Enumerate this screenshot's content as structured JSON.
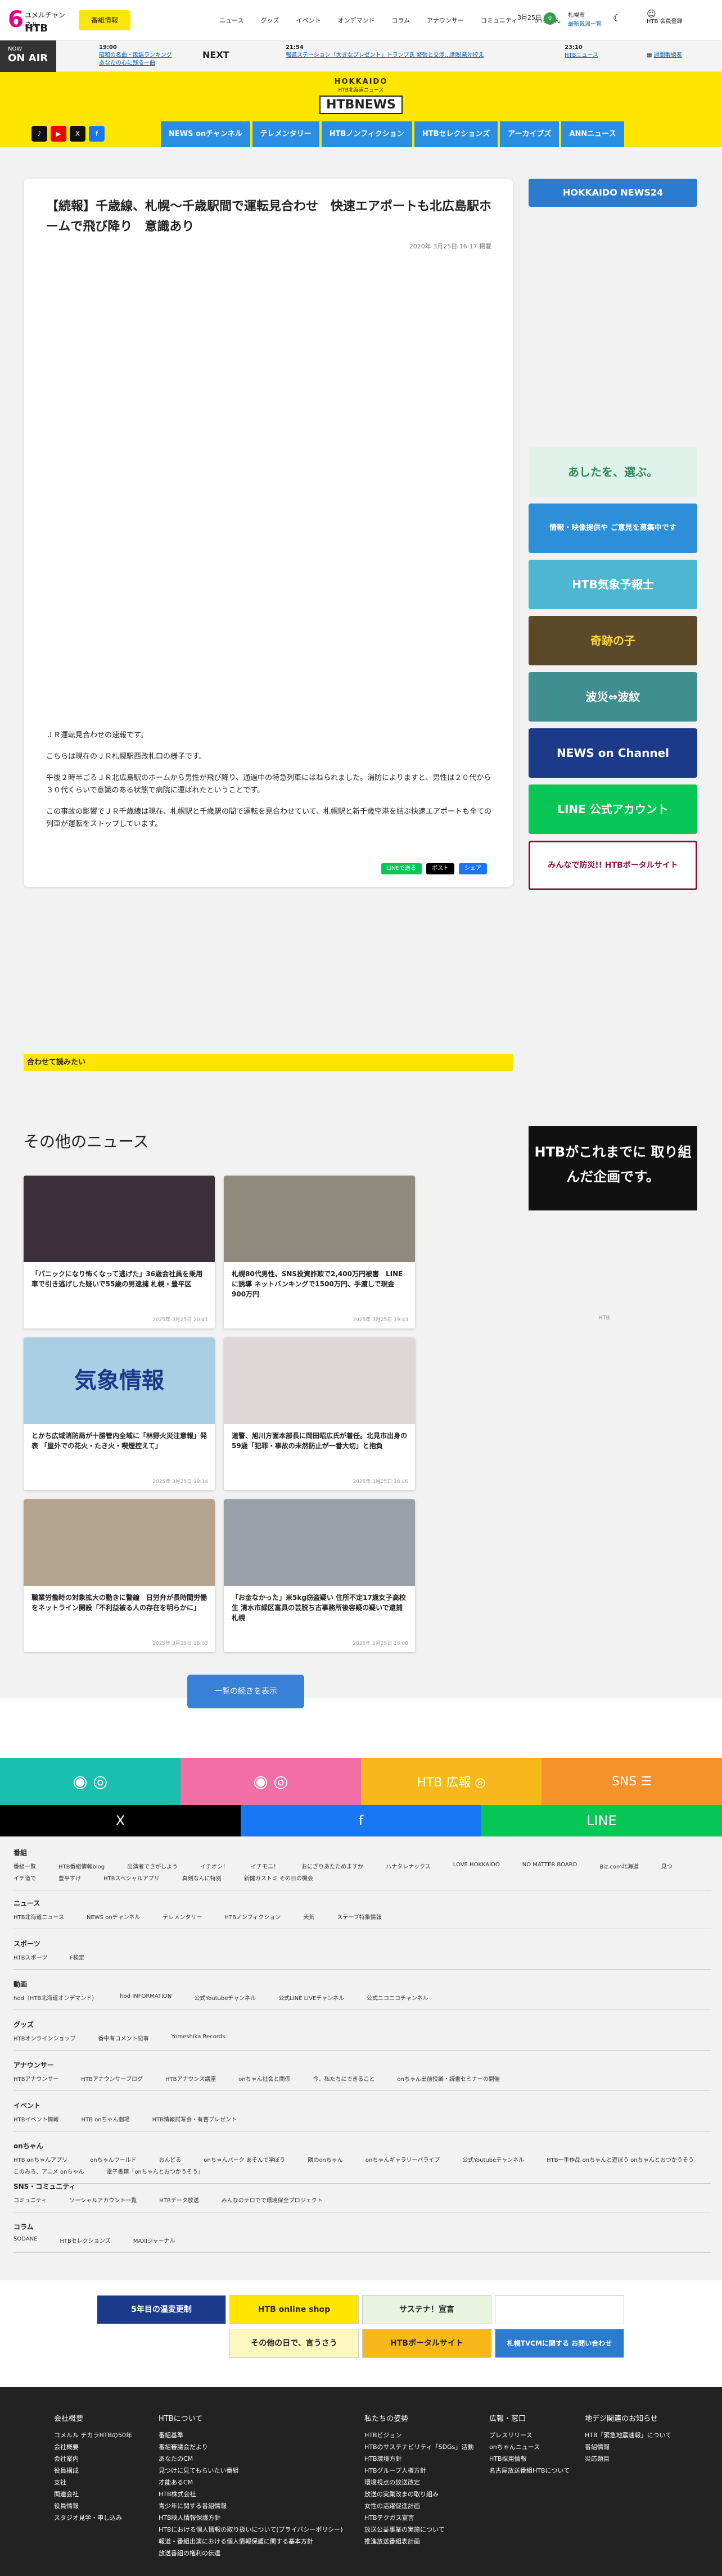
{
  "topbar": {
    "logo_kana": "ユメルチャンネル",
    "logo_six": "6",
    "logo_htb": "HTB",
    "yellow_button": "番組情報",
    "nav": [
      "ニュース",
      "グッズ",
      "イベント",
      "オンデマンド",
      "コラム",
      "アナウンサー",
      "コミュニティ",
      "onちゃん"
    ],
    "weather_date": "3月25日",
    "weather_badge": "0",
    "location_line1": "札幌市",
    "location_line2": "最新気温一覧",
    "account_line1": "HTB",
    "account_line2": "会員登録"
  },
  "onair": {
    "now_small": "NOW",
    "now_big": "ON AIR",
    "current_time": "19:00",
    "current_title": "昭和の名曲・歌謡ランキング",
    "current_sub": "あなたの心に残る一曲",
    "next_label": "NEXT",
    "next1_time": "21:54",
    "next1_title": "報道ステーション「大きなプレゼント」トランプ氏 緊張と交渉…関税発効控え",
    "next2_time": "23:10",
    "next2_title": "HTBニュース",
    "schedule": "週間番組表"
  },
  "header": {
    "hokkaido": "HOKKAIDO",
    "htb_news_sub": "HTB北海道ニュース",
    "logo": "HTBNEWS"
  },
  "social": [
    "♪",
    "▶",
    "X",
    "f"
  ],
  "menu": [
    "NEWS onチャンネル",
    "テレメンタリー",
    "HTBノンフィクション",
    "HTBセレクションズ",
    "アーカイブズ",
    "ANNニュース"
  ],
  "article": {
    "title": "【続報】千歳線、札幌～千歳駅間で運転見合わせ　快速エアポートも北広島駅ホームで飛び降り　意識あり",
    "date": "2020年 3月25日 16:17 掲載",
    "p1": "ＪＲ運転見合わせの速報です。",
    "p2": "こちらは現在のＪＲ札幌駅西改札口の様子です。",
    "p3": "午後２時半ごろＪＲ北広島駅のホームから男性が飛び降り、通過中の特急列車にはねられました。消防によりますと、男性は２０代から３０代くらいで意識のある状態で病院に運ばれたということです。",
    "p4": "この事故の影響でＪＲ千歳線は現在、札幌駅と千歳駅の間で運転を見合わせていて、札幌駅と新千歳空港を結ぶ快速エアポートも全ての列車が運転をストップしています。",
    "share_line": "LINEで送る",
    "share_x": "ポスト",
    "share_fb": "シェア"
  },
  "sidebar": {
    "news24": "HOKKAIDO NEWS24",
    "ashita": "あしたを、選ぶ。",
    "info": "情報・映像提供や ご意見を募集中です",
    "kisho": "HTB気象予報士",
    "kiseki": "奇跡の子",
    "shinsai": "波災⇔波紋",
    "newson": "NEWS on Channel",
    "line": "LINE 公式アカウント",
    "bousai": "みんなで防災!! HTBポータルサイト"
  },
  "related": "合わせて読みたい",
  "other_news": {
    "title": "その他のニュース",
    "cards": [
      {
        "caption": "「パニックになり怖くなって逃げた」36歳会社員を乗用車で引き逃げした疑いで55歳の男逮捕 札幌・豊平区",
        "date": "2025年 3月25日 20:41",
        "img": "#3a2f3a"
      },
      {
        "caption": "札幌80代男性、SNS投資詐欺で2,400万円被害　LINEに誘導 ネットバンキングで1500万円、手渡しで現金900万円",
        "date": "2025年 3月25日 19:43",
        "img": "#8f8a7e"
      },
      {
        "caption": "とかち広域消防局が十勝管内全域に「林野火災注意報」発表 「屋外での花火・たき火・喫煙控えて」",
        "date": "2025年 3月25日 19:14",
        "img": "#a9cfe5"
      },
      {
        "caption": "道警、旭川方面本部長に岡田昭広氏が着任。北見市出身の59歳「犯罪・事故の未然防止が一番大切」と抱負",
        "date": "2025年 3月25日 18:46",
        "img": "#ddd7d7"
      },
      {
        "caption": "職業労働時の対象拡大の動きに警鐘　日労弁が長時間労働をネットライン開設「不利益被る人の存在を明らかに」",
        "date": "2025年 3月25日 18:03",
        "img": "#b4a48e"
      },
      {
        "caption": "「お金なかった」米5kg窃盗疑い 住所不定17歳女子高校生 清水市緑区富具の芸脱ち古事務所後容疑の疑いで逮捕 札幌",
        "date": "2025年 3月25日 18:00",
        "img": "#9aa0a8"
      }
    ],
    "more": "一覧の続きを表示"
  },
  "ad": {
    "text": "HTBがこれまでに 取り組んだ企画です。",
    "note": "HTB"
  },
  "colorbar": [
    "◉ ◎",
    "◉ ◎",
    "HTB 広報 ◎",
    "SNS ☰"
  ],
  "sharebar": [
    "X",
    "f",
    "LINE"
  ],
  "sitemap": [
    {
      "h": "番組",
      "links": [
        "番組一覧",
        "HTB番組情報blog",
        "出演者でさがしよう",
        "イチオシ！",
        "イチモニ！",
        "おにぎりあたためますか",
        "ハナタレナックス",
        "LOVE HOKKAIDO",
        "NO MATTER BOARD",
        "Biz.com北海道",
        "見つ",
        "イチ道で",
        "豊平すけ",
        "HTBスペシャルアプリ",
        "真剣なんに特別",
        "新健ガストミ その日の機会"
      ]
    },
    {
      "h": "ニュース",
      "links": [
        "HTB北海道ニュース",
        "NEWS onチャンネル",
        "テレメンタリー",
        "HTBノンフィクション",
        "天気",
        "ステーブ特集情報"
      ]
    },
    {
      "h": "スポーツ",
      "links": [
        "HTBスポーツ",
        "F検定"
      ]
    },
    {
      "h": "動画",
      "links": [
        "hod（HTB北海道オンデマンド）",
        "hod INFORMATION",
        "公式Youtubeチャンネル",
        "公式LINE LIVEチャンネル",
        "公式ニコニコチャンネル"
      ]
    },
    {
      "h": "グッズ",
      "links": [
        "HTBオンラインショップ",
        "番中有コメント記事",
        "Yomeshika Records"
      ]
    },
    {
      "h": "アナウンサー",
      "links": [
        "HTBアナウンサー",
        "HTBアナウンサーブログ",
        "HTBアナウンス講座",
        "onちゃん社会と関係",
        "今、私たちにできること",
        "onちゃん出前授業・読書セミナーの開催"
      ]
    },
    {
      "h": "イベント",
      "links": [
        "HTBイベント情報",
        "HTB onちゃん劇場",
        "HTB情報試写会・有書プレゼント"
      ]
    },
    {
      "h": "onちゃん",
      "links": [
        "HTB onちゃんアプリ",
        "onちゃんワールド",
        "おんどる",
        "onちゃんパーク あそんで学ぼう",
        "隣のonちゃん",
        "onちゃんギャラリーパライブ",
        "公式Youtubeチャンネル",
        "HTB一手作品 onちゃんと遊ぼう onちゃんとおつかうそう",
        "このみろ、アニメ onちゃん",
        "電子書籍「onちゃんとおつかうそう」"
      ]
    },
    {
      "h": "SNS・コミュニティ",
      "links": [
        "コミュニティ",
        "ソーシャルアカウント一覧",
        "HTBデータ放送",
        "みんなのテロでで環境保全プロジェクト"
      ]
    },
    {
      "h": "コラム",
      "links": [
        "SODANE",
        "HTBセレクションズ",
        "MAXIジャーナル"
      ]
    }
  ],
  "banners2": [
    "5年目の温変更制",
    "HTB online shop",
    "サステナ！宣言",
    "その他の日で、言うさう",
    "HTBポータルサイト",
    "札幌TVCMに関する お問い合わせ"
  ],
  "footer": [
    {
      "h": "会社概要",
      "links": [
        "コメルル チカラHTBの50年",
        "会社概要",
        "会社案内",
        "役員構成",
        "支社",
        "関連会社",
        "役員情報",
        "スタジオ見学・申し込み"
      ]
    },
    {
      "h": "HTBについて",
      "links": [
        "番組基準",
        "番組審議会だより",
        "あなたのCM",
        "見つけに見てもらいたい番組",
        "才能あるCM",
        "HTB株式会社",
        "青少年に関する番組情報",
        "HTB映人情報保護方針",
        "HTBにおける個人情報の取り扱いについて(プライバシーポリシー)",
        "報道・番組出演における個人情報保護に関する基本方針",
        "放送番組の権利の伝達"
      ]
    },
    {
      "h": "私たちの姿勢",
      "links": [
        "HTBビジョン",
        "HTBのサステナビリティ「SDGs」活動",
        "HTB環境方針",
        "HTBグループ人権方針",
        "環境視点の放送改定",
        "放送の実業改まの取り組み",
        "女性の活躍促進計画",
        "HTBテクガス宣言",
        "放送公益事業の実施について",
        "推進放送番組表計画"
      ]
    },
    {
      "h": "広報・窓口",
      "links": [
        "プレスリリース",
        "onちゃんニュース",
        "HTB採用情報",
        "名古屋放送番組HTBについて"
      ]
    },
    {
      "h": "地デジ関連のお知らせ",
      "links": [
        "HTB「緊急地震速報」について",
        "番組情報",
        "災応題目"
      ]
    }
  ]
}
